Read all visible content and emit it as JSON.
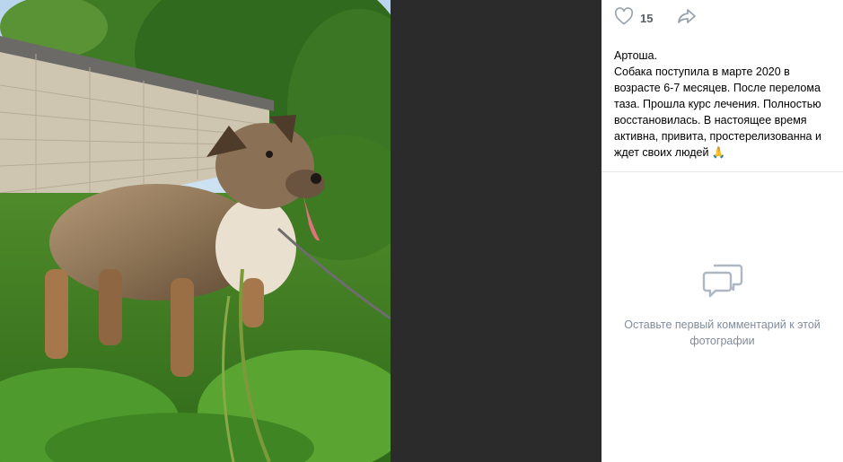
{
  "photo": {
    "alt": "dog-photo"
  },
  "sidebar": {
    "likes_count": "15",
    "like_icon": "heart-icon",
    "share_icon": "share-arrow-icon",
    "description": {
      "name": "Артоша.",
      "body": "Собака поступила в марте 2020 в возрасте 6-7 месяцев. После перелома таза. Прошла курс лечения. Полностью восстановилась. В настоящее время активна, привита, простерелизованна и ждет своих людей 🙏"
    },
    "comments": {
      "icon": "comments-icon",
      "empty_text": "Оставьте первый комментарий к этой фотографии"
    }
  },
  "colors": {
    "viewer_bg": "#2b2b2b",
    "icon_gray": "#99a2ad",
    "muted_text": "#818c99"
  }
}
